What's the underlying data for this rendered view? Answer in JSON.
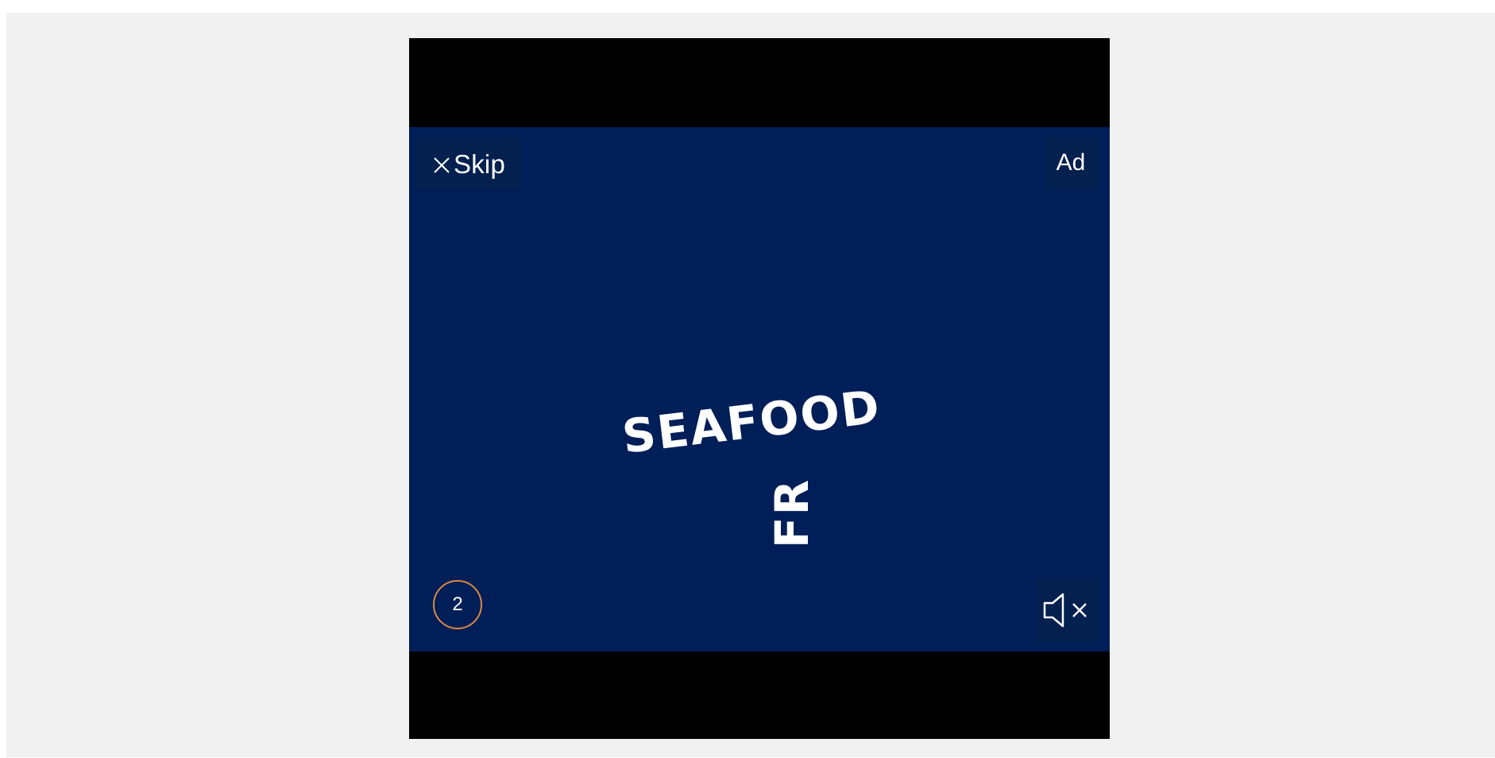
{
  "ad": {
    "skip_label": "Skip",
    "ad_badge": "Ad",
    "countdown": "2",
    "brand_text_line1": "SEAFOOD",
    "brand_text_line2": "FR"
  },
  "icons": {
    "skip": "close-icon",
    "mute": "speaker-muted-icon"
  },
  "colors": {
    "page_background": "#f1f1f1",
    "letterbox": "#000000",
    "video_background": "#001e57",
    "overlay_button": "#03204f",
    "countdown_ring": "#d98a40",
    "text": "#ffffff"
  }
}
